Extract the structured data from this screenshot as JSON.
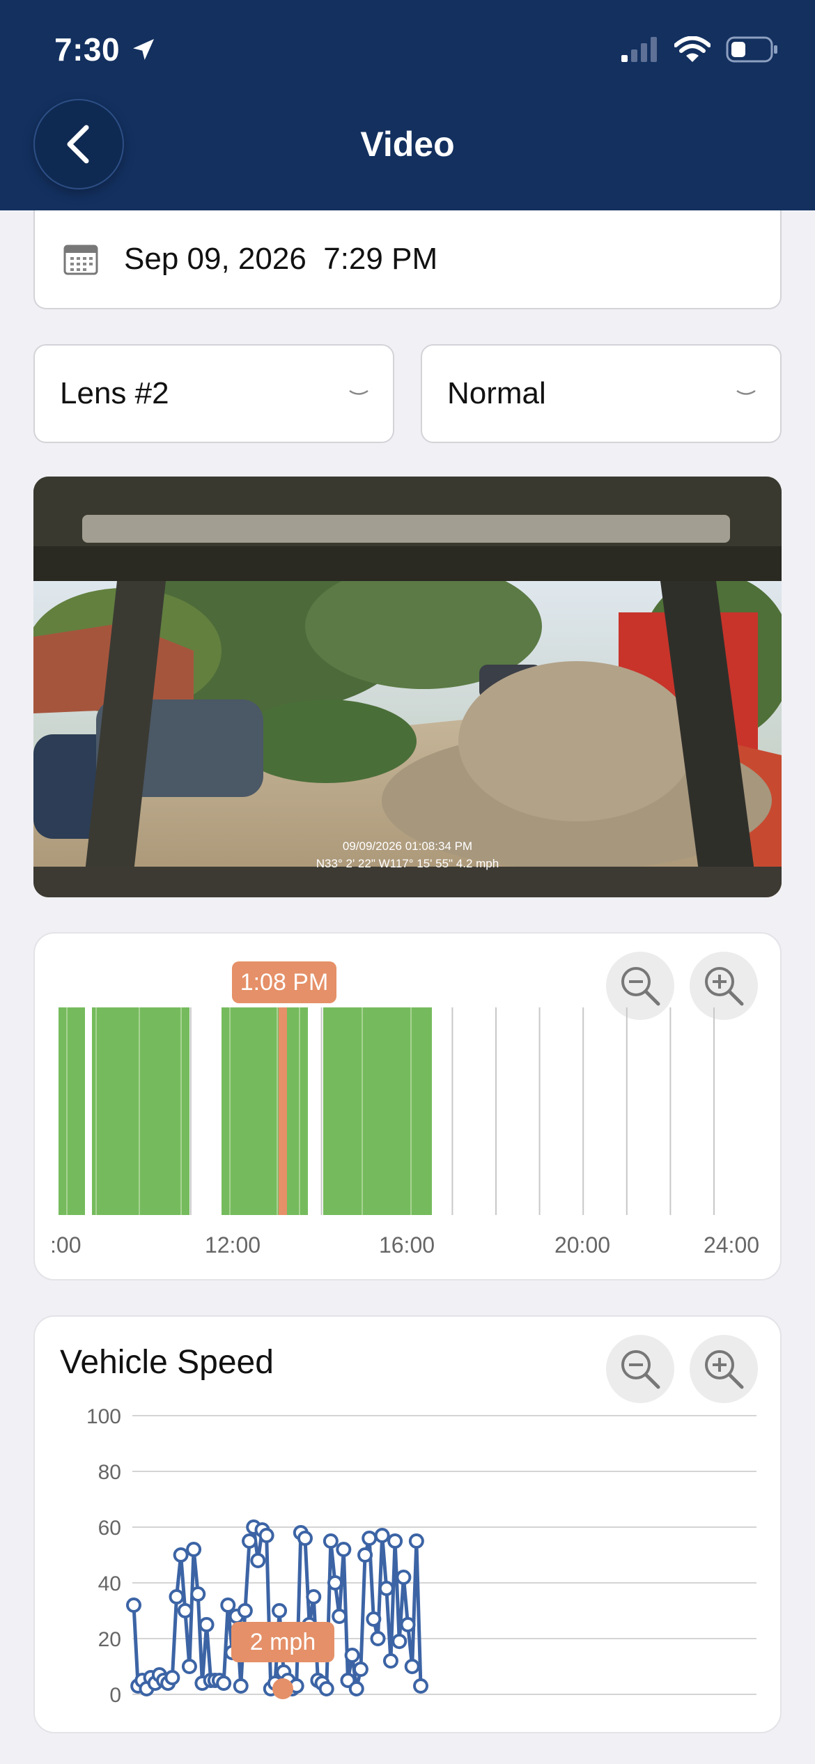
{
  "status_bar": {
    "time": "7:30"
  },
  "header": {
    "title": "Video"
  },
  "date_field": {
    "value": "Sep 09, 2026  7:29 PM"
  },
  "lens_select": {
    "value": "Lens #2"
  },
  "mode_select": {
    "value": "Normal"
  },
  "video": {
    "overlay_line1": "09/09/2026 01:08:34 PM",
    "overlay_line2": "N33° 2' 22\" W117° 15' 55\" 4.2 mph"
  },
  "timeline": {
    "tooltip": "1:08 PM",
    "tick_labels": [
      ":00",
      "12:00",
      "16:00",
      "20:00",
      "24:00"
    ],
    "colors": {
      "recording": "#75bb5d",
      "playhead": "#e59068",
      "gridline": "#c8c8c8"
    }
  },
  "speed": {
    "title": "Vehicle Speed",
    "tooltip": "2 mph",
    "colors": {
      "line": "#3c64a5",
      "highlight": "#e59068"
    }
  },
  "chart_data": {
    "type": "line",
    "title": "Vehicle Speed",
    "xlabel": "",
    "ylabel": "",
    "ylim": [
      0,
      100
    ],
    "yticks": [
      0,
      20,
      40,
      60,
      80,
      100
    ],
    "grid": true,
    "series": [
      {
        "values": [
          32,
          3,
          5,
          2,
          6,
          4,
          7,
          5,
          4,
          6,
          35,
          50,
          30,
          10,
          52,
          36,
          4,
          25,
          5,
          5,
          5,
          4,
          32,
          15,
          28,
          3,
          30,
          55,
          60,
          48,
          59,
          57,
          2,
          4,
          30,
          8,
          5,
          2,
          3,
          58,
          56,
          25,
          35,
          5,
          4,
          2,
          55,
          40,
          28,
          52,
          5,
          14,
          2,
          9,
          50,
          56,
          27,
          20,
          57,
          38,
          12,
          55,
          19,
          42,
          25,
          10,
          55,
          3
        ]
      }
    ],
    "highlight_value": 2
  }
}
